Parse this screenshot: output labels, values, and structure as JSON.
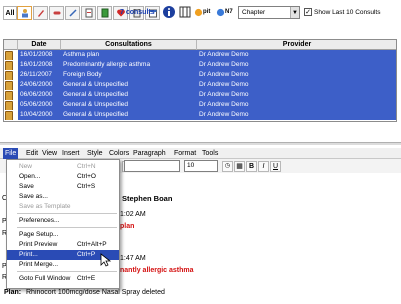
{
  "tabs": {
    "all": "All"
  },
  "header": {
    "consults": "7 consults",
    "pit": "pit",
    "n7": "N7",
    "chapter": "Chapter",
    "show_last": "Show Last 10 Consults"
  },
  "grid": {
    "columns": [
      "Date",
      "Consultations",
      "Provider"
    ],
    "rows": [
      {
        "date": "16/01/2008",
        "consult": "Asthma plan",
        "provider": "Dr Andrew Demo"
      },
      {
        "date": "16/01/2008",
        "consult": "Predominantly allergic asthma",
        "provider": "Dr Andrew Demo"
      },
      {
        "date": "26/11/2007",
        "consult": "Foreign Body",
        "provider": "Dr Andrew Demo"
      },
      {
        "date": "24/06/2000",
        "consult": "General & Unspecified",
        "provider": "Dr Andrew Demo"
      },
      {
        "date": "06/06/2000",
        "consult": "General & Unspecified",
        "provider": "Dr Andrew Demo"
      },
      {
        "date": "05/06/2000",
        "consult": "General & Unspecified",
        "provider": "Dr Andrew Demo"
      },
      {
        "date": "10/04/2000",
        "consult": "General & Unspecified",
        "provider": "Dr Andrew Demo"
      }
    ]
  },
  "menubar": [
    "File",
    "Edit",
    "View",
    "Insert",
    "Style",
    "Colors",
    "Paragraph",
    "Format",
    "Tools"
  ],
  "file_menu": [
    {
      "label": "New",
      "shortcut": "Ctrl+N",
      "disabled": true
    },
    {
      "label": "Open...",
      "shortcut": "Ctrl+O"
    },
    {
      "label": "Save",
      "shortcut": "Ctrl+S"
    },
    {
      "label": "Save as..."
    },
    {
      "label": "Save as Template",
      "disabled": true
    },
    {
      "label": "Preferences..."
    },
    {
      "label": "Page Setup..."
    },
    {
      "label": "Print Preview",
      "shortcut": "Ctrl+Alt+P"
    },
    {
      "label": "Print...",
      "shortcut": "Ctrl+P",
      "highlighted": true
    },
    {
      "label": "Print Merge..."
    },
    {
      "label": "Goto Full Window",
      "shortcut": "Ctrl+E"
    }
  ],
  "toolbar": {
    "font_size": "10",
    "bold": "B",
    "italic": "I",
    "underline": "U"
  },
  "document": {
    "line1": "Stephen Boan",
    "line2": "1:02 AM",
    "line3": "plan",
    "line4": "1:47 AM",
    "line5": "nantly allergic asthma",
    "plan_label": "Plan:",
    "plan_text": "Rhinocort 100mcg/dose Nasal Spray deleted",
    "frag_c": "C",
    "frag_p": "P",
    "frag_r": "R"
  },
  "colors": {
    "selection": "#3d5fc8",
    "menu_highlight": "#2a4bb5",
    "diagnosis_red": "#d41010",
    "consult_count": "#1a3fb0"
  }
}
